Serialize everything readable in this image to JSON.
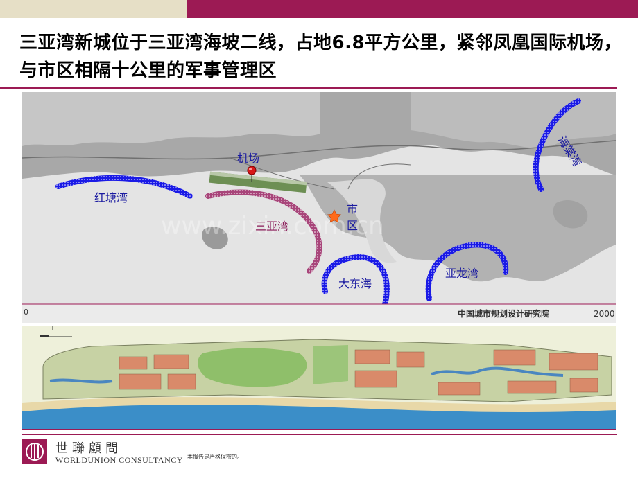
{
  "slide": {
    "headline": "三亚湾新城位于三亚湾海坡二线，占地6.8平方公里，紧邻凤凰国际机场，与市区相隔十公里的军事管理区"
  },
  "map": {
    "labels": {
      "airport": "机场",
      "city_line1": "市",
      "city_line2": "区",
      "hongtang_bay": "红塘湾",
      "sanya_bay": "三亚湾",
      "dadonghai": "大东海",
      "yalong_bay": "亚龙湾",
      "haitang_bay": "海棠湾"
    },
    "institute": "中国城市规划设计研究院",
    "year": "2000",
    "scale_left": "0",
    "watermark": "www.zixin.com.cn",
    "colors": {
      "bay_marker": "#1a1ae6",
      "sanya_bay_marker": "#b04a80",
      "airport_pin": "#d81818",
      "city_star": "#ff6a1a"
    }
  },
  "footer": {
    "brand_cn": "世聯顧問",
    "brand_en": "WORLDUNION CONSULTANCY",
    "confidential": "本报告是严格保密的。"
  }
}
